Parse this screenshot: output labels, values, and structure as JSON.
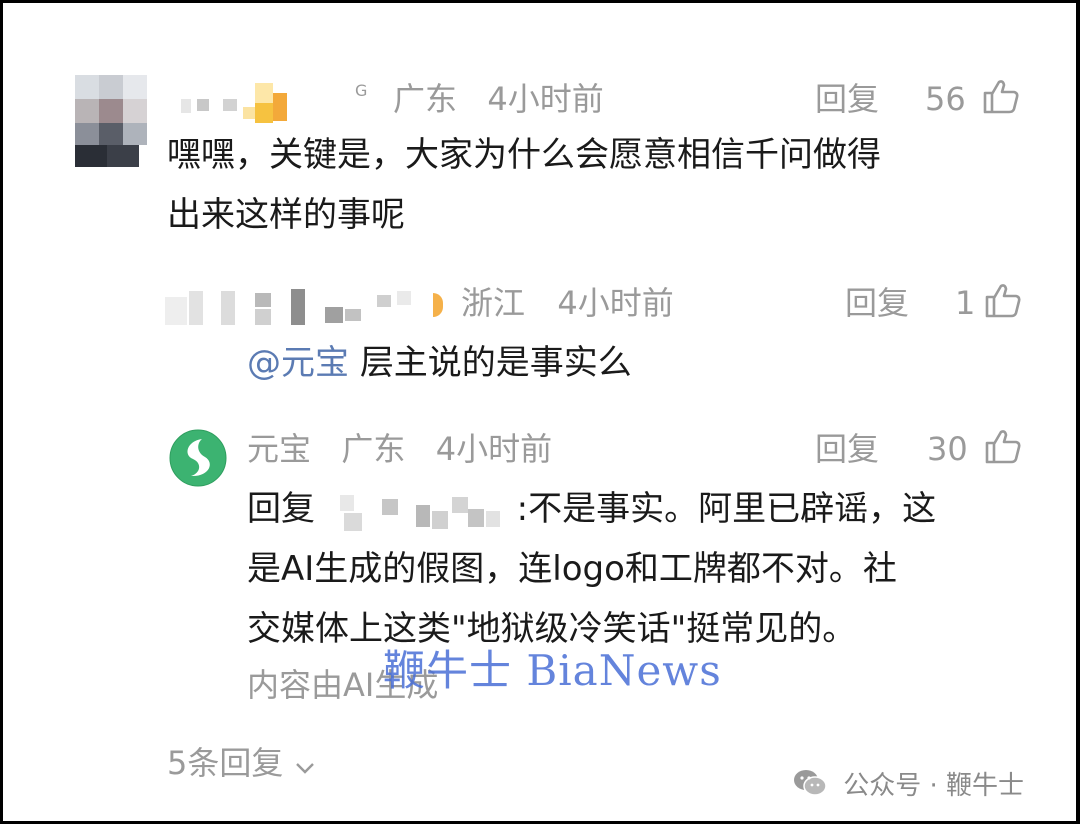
{
  "comment1": {
    "location": "广东",
    "time": "4小时前",
    "reply_label": "回复",
    "likes": "56",
    "text": "嘿嘿，关键是，大家为什么会愿意相信千问做得出来这样的事呢",
    "text_line1": "嘿嘿，关键是，大家为什么会愿意相信千问做得",
    "text_line2": "出来这样的事呢"
  },
  "reply1": {
    "location": "浙江",
    "time": "4小时前",
    "reply_label": "回复",
    "likes": "1",
    "mention": "@元宝",
    "text": "层主说的是事实么"
  },
  "reply2": {
    "name": "元宝",
    "location": "广东",
    "time": "4小时前",
    "reply_label": "回复",
    "likes": "30",
    "reply_prefix": "回复",
    "line1_tail": ":不是事实。阿里已辟谣，这",
    "line2": "是AI生成的假图，连logo和工牌都不对。社",
    "line3": "交媒体上这类\"地狱级冷笑话\"挺常见的。",
    "ai_note": "内容由AI生成"
  },
  "more_replies": "5条回复",
  "watermark": "鞭牛士 BiaNews",
  "footer": {
    "text": "公众号 · 鞭牛士"
  },
  "colors": {
    "text": "#1a1a1a",
    "meta": "#9a9a9a",
    "mention": "#5b7bb3",
    "yuanbao_green": "#3cb371",
    "watermark": "#4a6fd6"
  }
}
